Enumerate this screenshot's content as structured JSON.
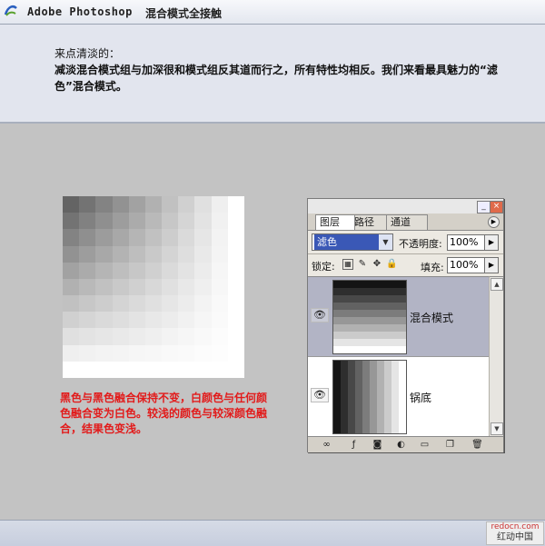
{
  "app": {
    "title": "Adobe Photoshop",
    "subtitle": "混合模式全接触"
  },
  "intro": {
    "heading": "来点清淡的：",
    "paragraph": "减淡混合模式组与加深很和模式组反其道而行之，所有特性均相反。我们来看最具魅力的“滤色”混合模式。"
  },
  "caption": "黑色与黑色融合保持不变，白颜色与任何颜色融合变为白色。较浅的颜色与较深颜色融合，结果色变浅。",
  "panel": {
    "window_buttons": {
      "minimize": "_",
      "close": "×"
    },
    "tabs": [
      "图层",
      "路径",
      "通道"
    ],
    "menu_icon": "menu-arrow-icon",
    "blend_mode": "滤色",
    "opacity_label": "不透明度:",
    "opacity_value": "100%",
    "lock_label": "锁定:",
    "fill_label": "填充:",
    "fill_value": "100%",
    "layers": [
      {
        "name": "混合模式",
        "selected": true,
        "thumbnail": "horizontal-gradient-bands"
      },
      {
        "name": "锅底",
        "selected": false,
        "thumbnail": "vertical-gradient-bands"
      }
    ],
    "bottom_icons": [
      "link-icon",
      "layer-style-icon",
      "mask-icon",
      "adjustment-icon",
      "folder-icon",
      "new-layer-icon",
      "trash-icon"
    ]
  },
  "watermark": {
    "line1": "redocn.com",
    "line2": "红动中国"
  }
}
